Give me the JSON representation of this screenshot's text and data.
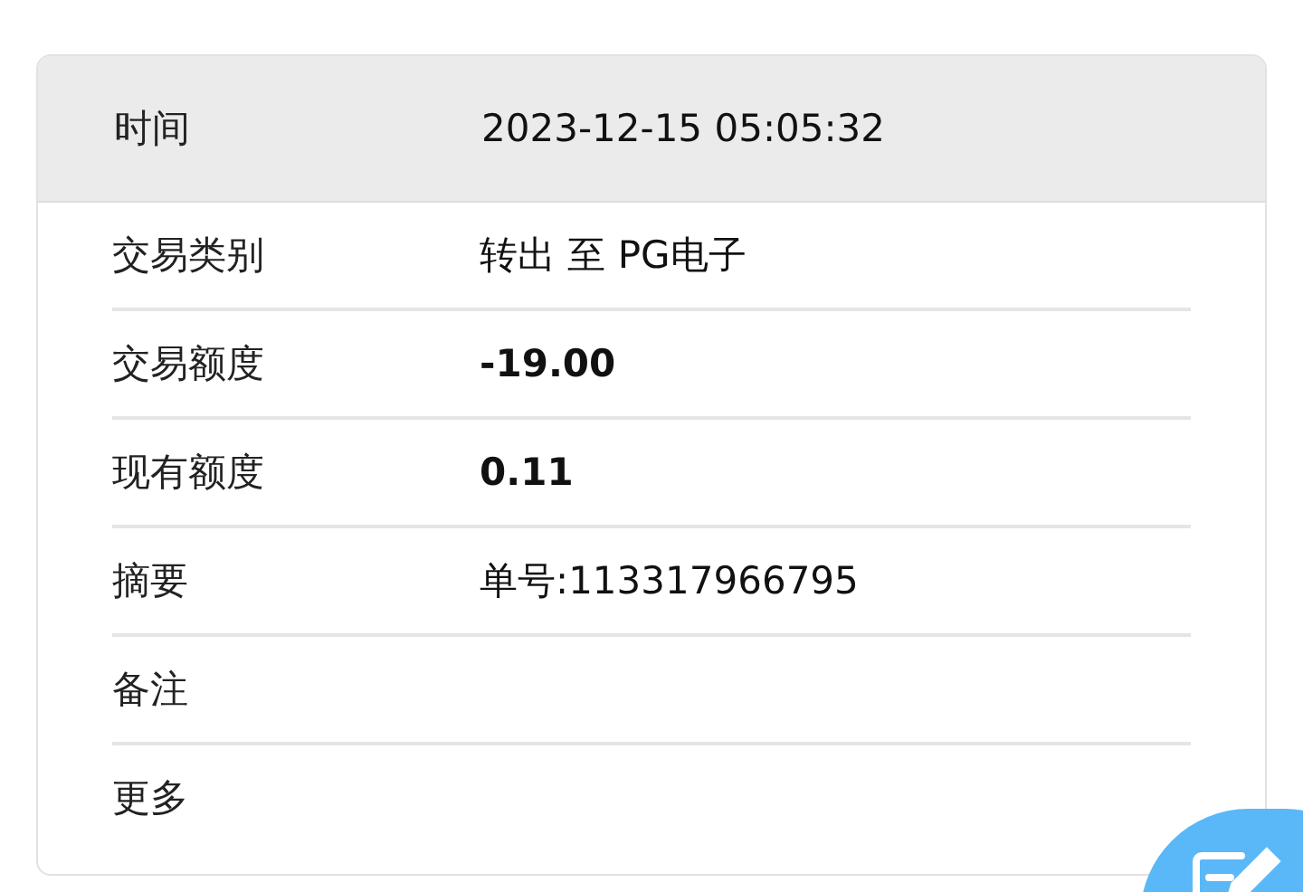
{
  "header": {
    "label": "时间",
    "value": "2023-12-15 05:05:32"
  },
  "rows": [
    {
      "label": "交易类别",
      "value": "转出 至 PG电子"
    },
    {
      "label": "交易额度",
      "value": "-19.00",
      "bold": true
    },
    {
      "label": "现有额度",
      "value": "0.11",
      "bold": true
    },
    {
      "label": "摘要",
      "value": "单号:113317966795"
    },
    {
      "label": "备注"
    },
    {
      "label": "更多"
    }
  ]
}
